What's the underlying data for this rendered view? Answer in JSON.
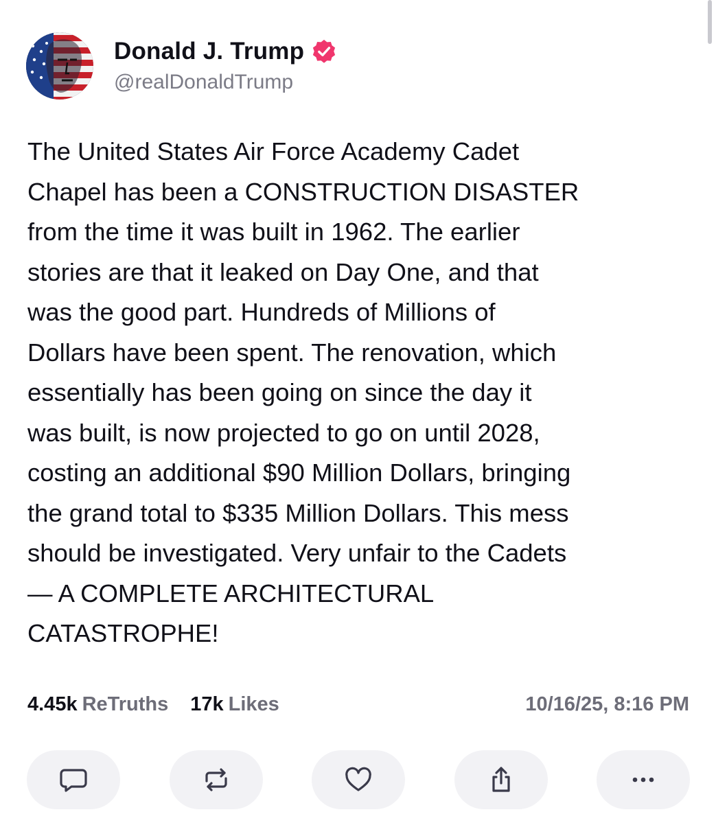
{
  "post": {
    "author": {
      "display_name": "Donald J. Trump",
      "handle": "@realDonaldTrump",
      "verified_badge_color": "#f0366d",
      "avatar_icon": "profile-avatar-flag-portrait"
    },
    "text": "The United States Air Force Academy Cadet\nChapel has been a CONSTRUCTION DISASTER\nfrom the time it was built in 1962. The earlier\nstories are that it leaked on Day One, and that\nwas the good part. Hundreds of Millions of\nDollars have been spent. The renovation, which\nessentially has been going on since the day it\nwas built, is now projected to go on until 2028,\ncosting an additional $90 Million Dollars, bringing\nthe grand total to $335 Million Dollars. This mess\nshould be investigated. Very unfair to the Cadets\n— A COMPLETE ARCHITECTURAL\nCATASTROPHE!",
    "stats": {
      "retruths_count": "4.45k",
      "retruths_label": "ReTruths",
      "likes_count": "17k",
      "likes_label": "Likes"
    },
    "timestamp": "10/16/25, 8:16 PM"
  },
  "actions": [
    {
      "name": "reply",
      "icon": "speech-bubble-icon"
    },
    {
      "name": "retruth",
      "icon": "repost-arrows-icon"
    },
    {
      "name": "like",
      "icon": "heart-icon"
    },
    {
      "name": "share",
      "icon": "share-icon"
    },
    {
      "name": "more",
      "icon": "ellipsis-icon"
    }
  ],
  "colors": {
    "text_primary": "#101018",
    "text_secondary": "#6d6d78",
    "button_bg": "#f2f2f5",
    "icon_color": "#3a3a4a"
  }
}
